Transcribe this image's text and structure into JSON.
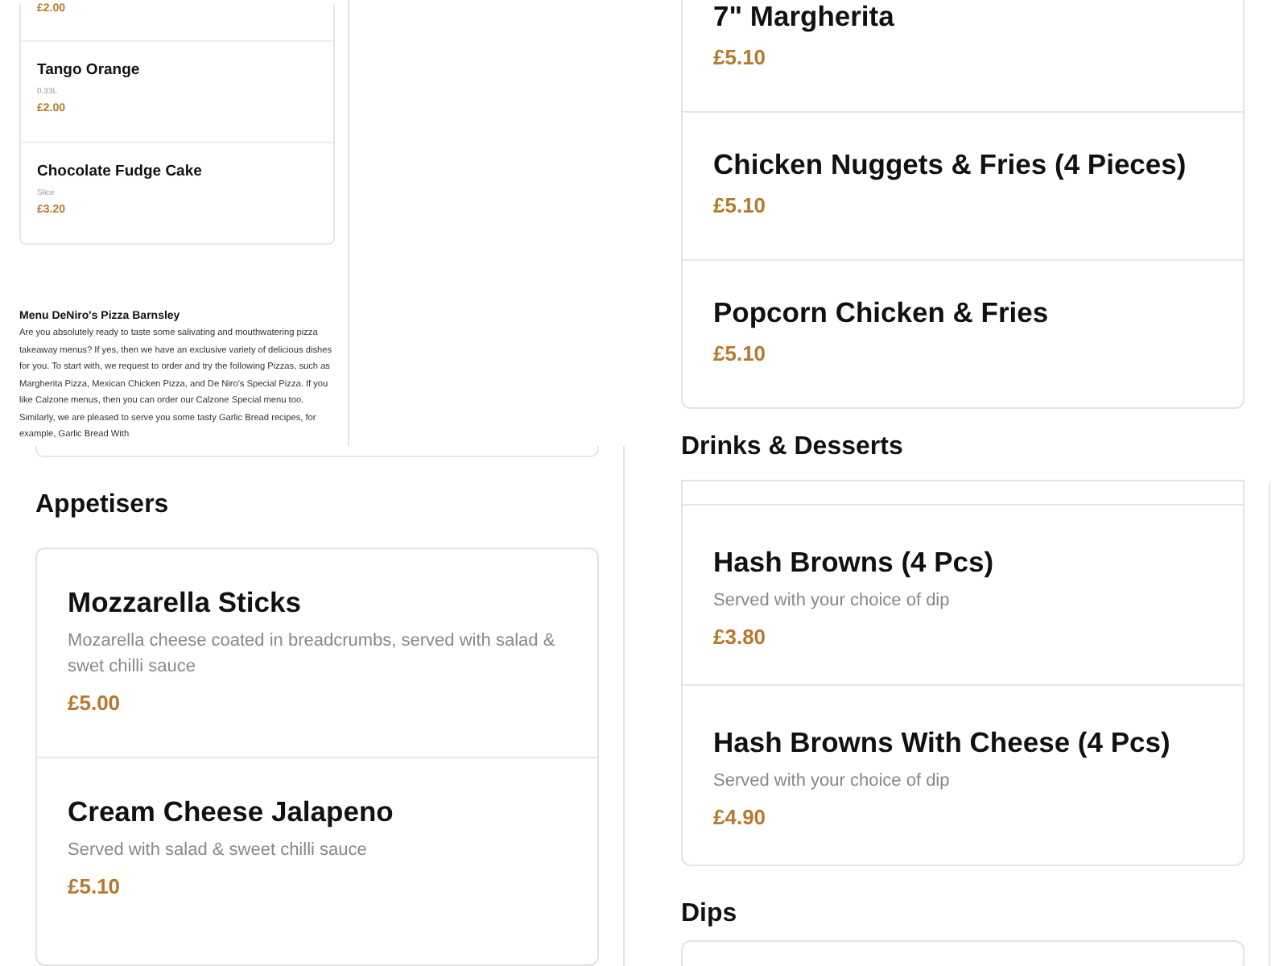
{
  "side_panel": {
    "items": [
      {
        "price": "£2.00"
      },
      {
        "name": "Tango Orange",
        "note": "0.33L",
        "price": "£2.00"
      },
      {
        "name": "Chocolate Fudge Cake",
        "note": "Slice",
        "price": "£3.20"
      }
    ],
    "about": {
      "title": "Menu DeNiro's Pizza Barnsley",
      "text": "Are you absolutely ready to taste some salivating and mouthwatering pizza takeaway menus? If yes, then we have an exclusive variety of delicious dishes for you. To start with, we request to order and try the following Pizzas, such as Margherita Pizza, Mexican Chicken Pizza, and De Niro's Special Pizza. If you like Calzone menus, then you can order our Calzone Special menu too. Similarly, we are pleased to serve you some tasty Garlic Bread recipes, for example, Garlic Bread With"
    }
  },
  "left_sections": [
    {
      "heading": "Appetisers",
      "items": [
        {
          "name": "Mozzarella Sticks",
          "description": "Mozarella cheese coated in breadcrumbs, served with salad & swet chilli sauce",
          "price": "£5.00"
        },
        {
          "name": "Cream Cheese Jalapeno",
          "description": "Served with salad & sweet chilli sauce",
          "price": "£5.10"
        }
      ]
    }
  ],
  "right_sections": [
    {
      "items": [
        {
          "name": "7\" Margherita",
          "price": "£5.10"
        },
        {
          "name": "Chicken Nuggets & Fries (4 Pieces)",
          "price": "£5.10"
        },
        {
          "name": "Popcorn Chicken & Fries",
          "price": "£5.10"
        }
      ]
    },
    {
      "heading": "Drinks & Desserts",
      "items": [
        {
          "name": "Hash Browns (4 Pcs)",
          "description": "Served with your choice of dip",
          "price": "£3.80"
        },
        {
          "name": "Hash Browns With Cheese (4 Pcs)",
          "description": "Served with your choice of dip",
          "price": "£4.90"
        }
      ]
    },
    {
      "heading": "Dips"
    }
  ]
}
